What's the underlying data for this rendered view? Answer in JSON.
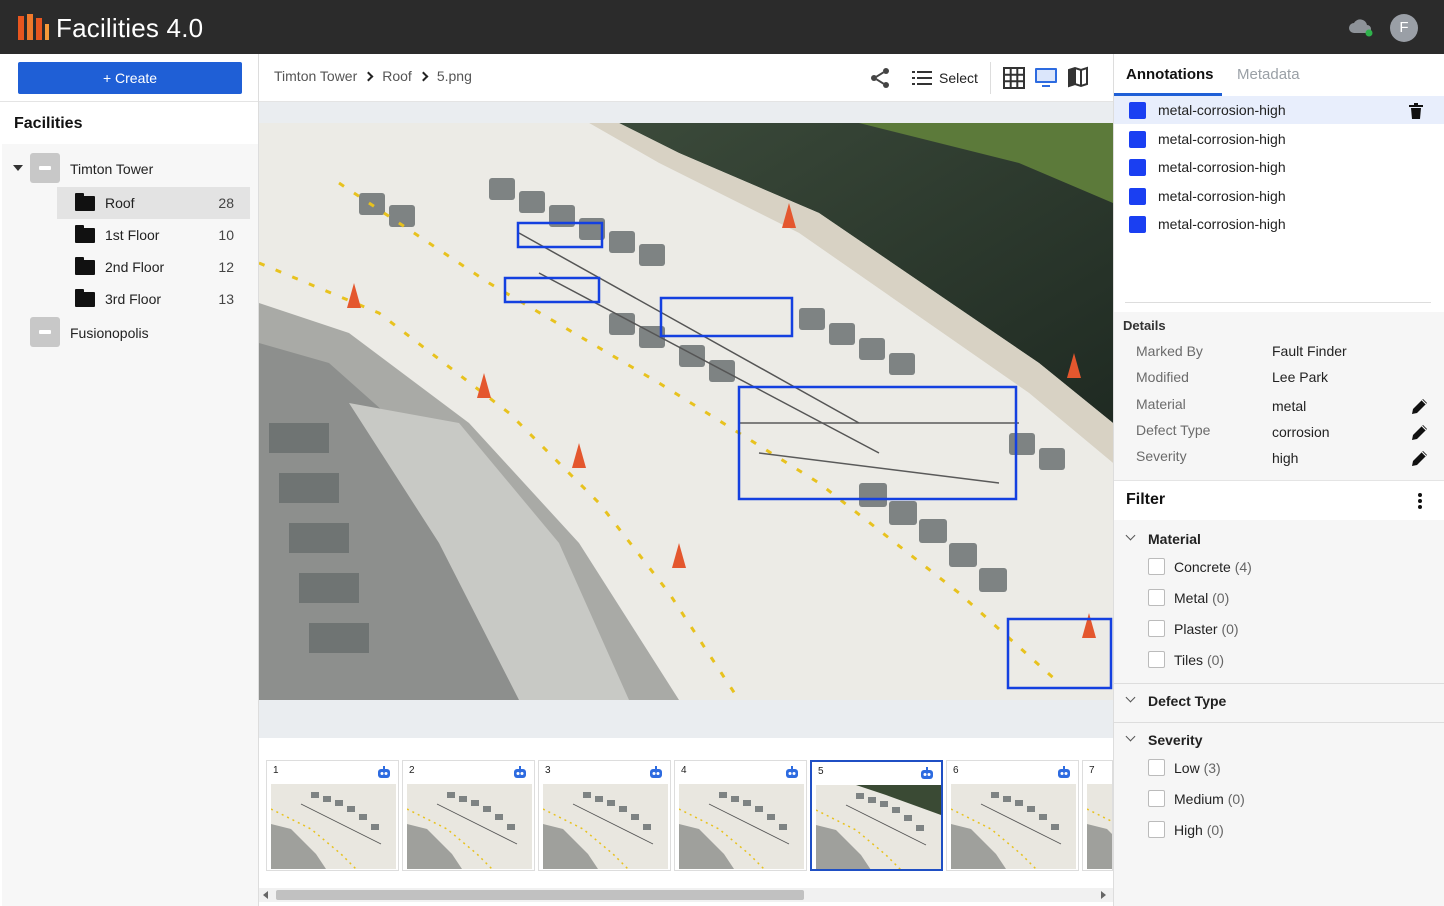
{
  "app": {
    "title": "Facilities 4.0",
    "user_initial": "F"
  },
  "left": {
    "create_label": "+ Create",
    "facilities_title": "Facilities",
    "tree": [
      {
        "name": "Timton Tower",
        "expanded": true,
        "children": [
          {
            "name": "Roof",
            "count": "28",
            "selected": true
          },
          {
            "name": "1st Floor",
            "count": "10"
          },
          {
            "name": "2nd Floor",
            "count": "12"
          },
          {
            "name": "3rd Floor",
            "count": "13"
          }
        ]
      },
      {
        "name": "Fusionopolis",
        "expanded": false
      }
    ]
  },
  "breadcrumb": [
    "Timton Tower",
    "Roof",
    "5.png"
  ],
  "toolbar": {
    "select_label": "Select"
  },
  "thumbnails": [
    {
      "num": "1"
    },
    {
      "num": "2"
    },
    {
      "num": "3"
    },
    {
      "num": "4"
    },
    {
      "num": "5",
      "selected": true
    },
    {
      "num": "6"
    },
    {
      "num": "7"
    }
  ],
  "right": {
    "tabs": {
      "annotations": "Annotations",
      "metadata": "Metadata"
    },
    "annotations": [
      {
        "label": "metal-corrosion-high",
        "color": "#1a3ff2"
      },
      {
        "label": "metal-corrosion-high",
        "color": "#1a3ff2"
      },
      {
        "label": "metal-corrosion-high",
        "color": "#1a3ff2"
      },
      {
        "label": "metal-corrosion-high",
        "color": "#1a3ff2"
      },
      {
        "label": "metal-corrosion-high",
        "color": "#1a3ff2"
      }
    ],
    "details_title": "Details",
    "details": [
      {
        "key": "Marked By",
        "value": "Fault Finder",
        "editable": false
      },
      {
        "key": "Modified",
        "value": "Lee Park",
        "editable": false
      },
      {
        "key": "Material",
        "value": "metal",
        "editable": true
      },
      {
        "key": "Defect Type",
        "value": "corrosion",
        "editable": true
      },
      {
        "key": "Severity",
        "value": "high",
        "editable": true
      }
    ],
    "filter": {
      "title": "Filter",
      "sections": [
        {
          "title": "Material",
          "options": [
            {
              "label": "Concrete",
              "count": "(4)"
            },
            {
              "label": "Metal",
              "count": "(0)"
            },
            {
              "label": "Plaster",
              "count": "(0)"
            },
            {
              "label": "Tiles",
              "count": "(0)"
            }
          ]
        },
        {
          "title": "Defect Type",
          "options": []
        },
        {
          "title": "Severity",
          "options": [
            {
              "label": "Low",
              "count": "(3)"
            },
            {
              "label": "Medium",
              "count": "(0)"
            },
            {
              "label": "High",
              "count": "(0)"
            }
          ]
        }
      ]
    }
  },
  "colors": {
    "accent": "#1f5fd6",
    "bbox": "#1440e0",
    "header": "#2b2b2b",
    "logo": "#e8561f"
  }
}
